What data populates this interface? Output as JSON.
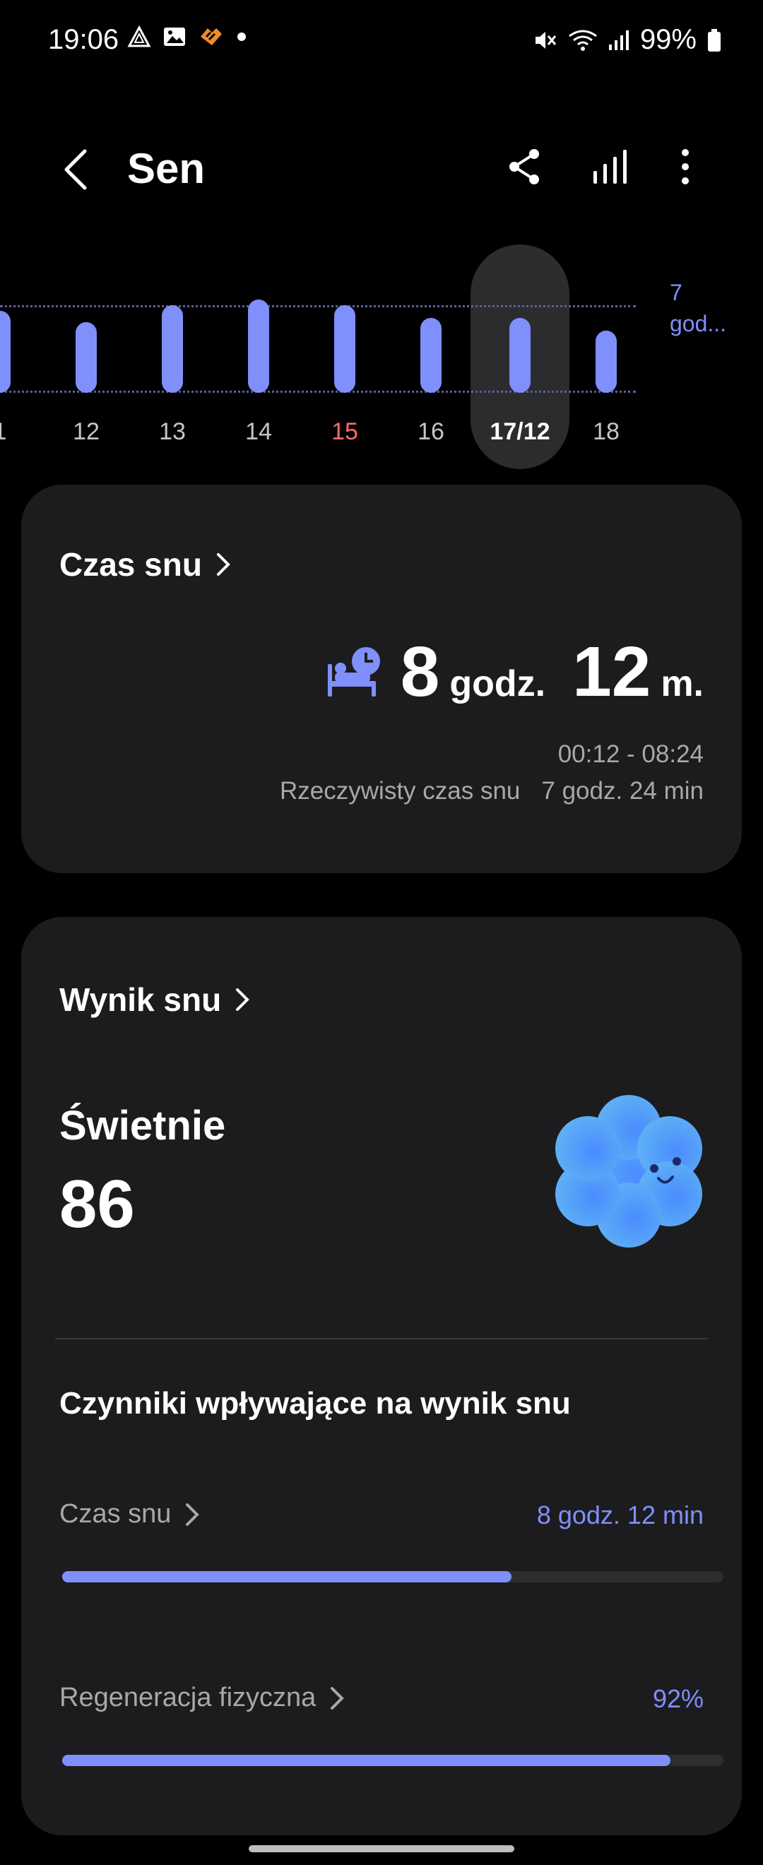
{
  "status": {
    "time": "19:06",
    "battery": "99%"
  },
  "header": {
    "title": "Sen"
  },
  "week": {
    "days": [
      {
        "label": "1",
        "rel": 0.58
      },
      {
        "label": "12",
        "rel": 0.5
      },
      {
        "label": "13",
        "rel": 0.62
      },
      {
        "label": "14",
        "rel": 0.66
      },
      {
        "label": "15",
        "rel": 0.62,
        "color": "#ff6b6b"
      },
      {
        "label": "16",
        "rel": 0.53
      },
      {
        "label": "17/12",
        "rel": 0.53,
        "selected": true
      },
      {
        "label": "18",
        "rel": 0.44
      }
    ],
    "goal_value": "7",
    "goal_unit": "god..."
  },
  "sleep_time_card": {
    "title": "Czas snu",
    "hours": "8",
    "hours_unit": "godz.",
    "minutes": "12",
    "minutes_unit": "m.",
    "range": "00:12 - 08:24",
    "actual_label": "Rzeczywisty czas snu",
    "actual_value": "7 godz. 24 min"
  },
  "sleep_score_card": {
    "title": "Wynik snu",
    "rating": "Świetnie",
    "score": "86",
    "factors_title": "Czynniki wpływające na wynik snu",
    "factors": [
      {
        "label": "Czas snu",
        "value": "8 godz. 12 min",
        "progress": 0.68
      },
      {
        "label": "Regeneracja fizyczna",
        "value": "92%",
        "progress": 0.92
      }
    ]
  },
  "colors": {
    "accent": "#7f8ffb",
    "card": "#1c1c1e",
    "weekend": "#ff6b6b"
  }
}
